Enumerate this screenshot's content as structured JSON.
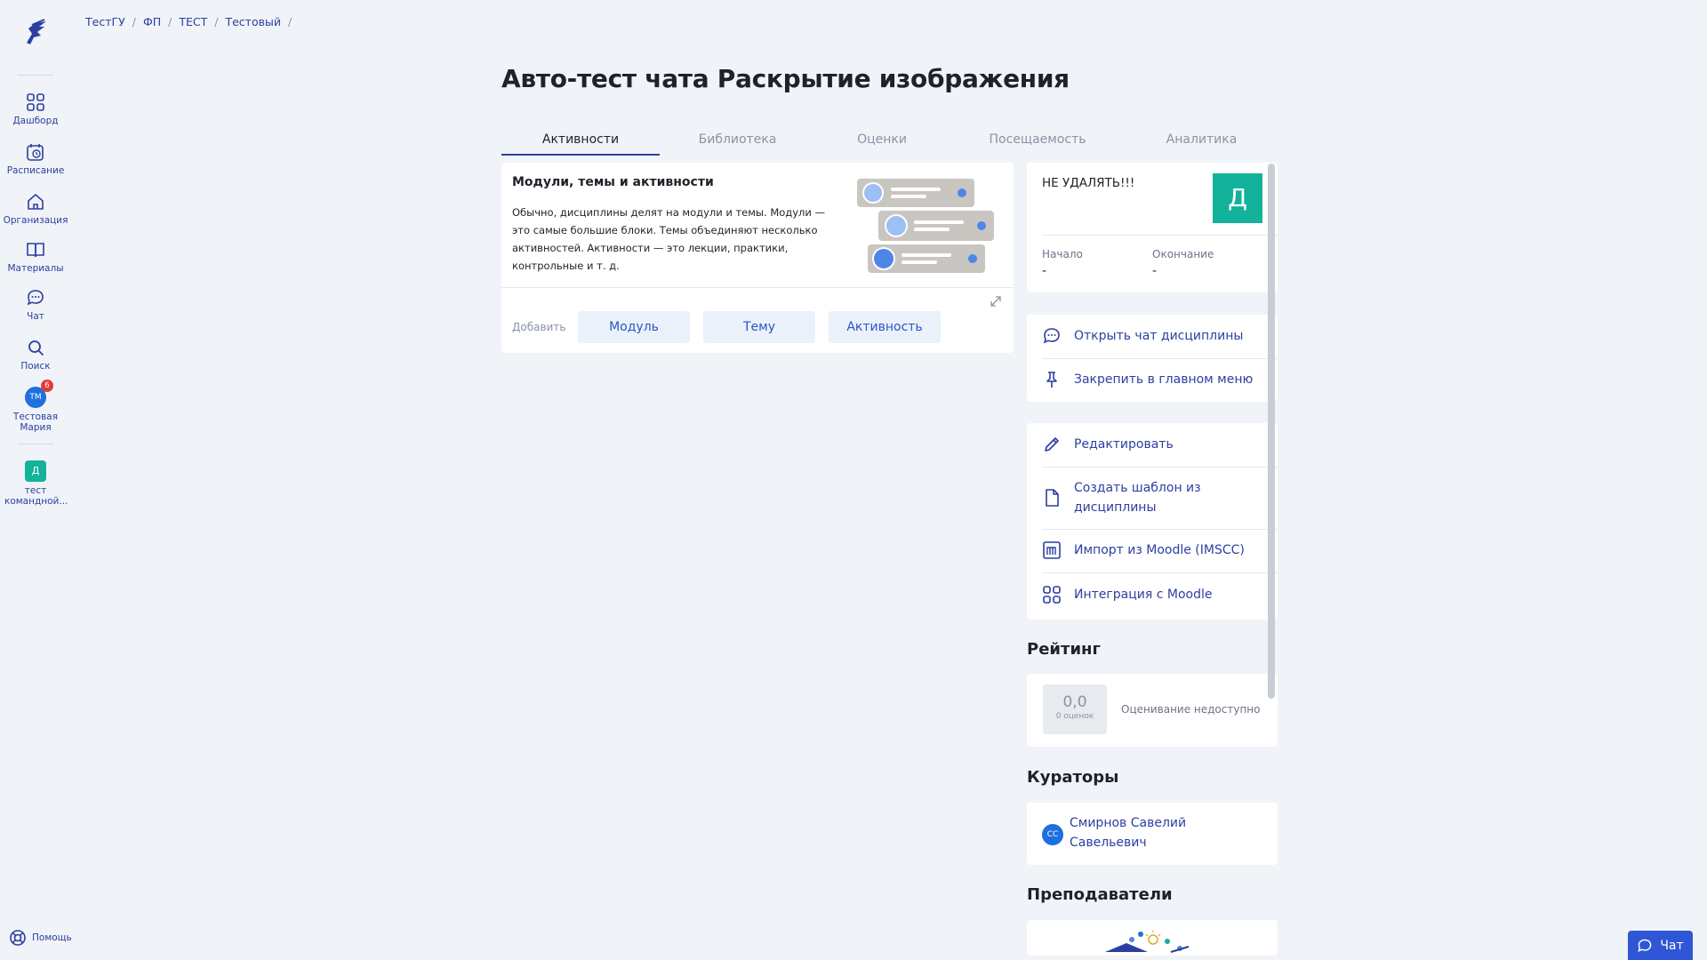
{
  "sidebar": {
    "items": [
      {
        "label": "Дашборд",
        "icon": "dashboard-icon"
      },
      {
        "label": "Расписание",
        "icon": "schedule-icon"
      },
      {
        "label": "Организация",
        "icon": "organization-icon"
      },
      {
        "label": "Материалы",
        "icon": "book-icon"
      },
      {
        "label": "Чат",
        "icon": "chat-icon"
      },
      {
        "label": "Поиск",
        "icon": "search-icon"
      }
    ],
    "user": {
      "initials": "ТМ",
      "badge": "6",
      "label": "Тестовая Мария"
    },
    "team": {
      "initial": "Д",
      "label": "тест командной..."
    },
    "help_label": "Помощь"
  },
  "breadcrumb": {
    "items": [
      "ТестГУ",
      "ФП",
      "ТЕСТ",
      "Тестовый"
    ],
    "separator": "/"
  },
  "page": {
    "title": "Авто-тест чата Раскрытие изображения"
  },
  "tabs": [
    "Активности",
    "Библиотека",
    "Оценки",
    "Посещаемость",
    "Аналитика"
  ],
  "modules": {
    "title": "Модули, темы и активности",
    "text": "Обычно, дисциплины делят на модули и темы. Модули — это самые большие блоки. Темы объединяют несколько активностей. Активности — это лекции, практики, контрольные и т. д.",
    "add_label": "Добавить",
    "buttons": [
      "Модуль",
      "Тему",
      "Активность"
    ]
  },
  "info": {
    "name": "НЕ УДАЛЯТЬ!!!",
    "initial": "Д",
    "start_label": "Начало",
    "start_value": "-",
    "end_label": "Окончание",
    "end_value": "-"
  },
  "actions1": [
    {
      "label": "Открыть чат дисциплины",
      "icon": "chat-bubble-icon"
    },
    {
      "label": "Закрепить в главном меню",
      "icon": "pin-icon"
    }
  ],
  "actions2": [
    {
      "label": "Редактировать",
      "icon": "pencil-icon"
    },
    {
      "label": "Создать шаблон из дисциплины",
      "icon": "document-icon"
    },
    {
      "label": "Импорт из Moodle (IMSCC)",
      "icon": "moodle-icon"
    },
    {
      "label": "Интеграция с Moodle",
      "icon": "grid-icon"
    }
  ],
  "rating": {
    "heading": "Рейтинг",
    "value": "0,0",
    "count": "0 оценок",
    "status": "Оценивание недоступно"
  },
  "curators": {
    "heading": "Кураторы",
    "initials": "СС",
    "name": "Смирнов Савелий Савельевич"
  },
  "teachers": {
    "heading": "Преподаватели"
  },
  "chat_button": {
    "label": "Чат"
  },
  "colors": {
    "accent": "#2b3fa0",
    "teal": "#13b29a",
    "background": "#f0f3f7"
  }
}
